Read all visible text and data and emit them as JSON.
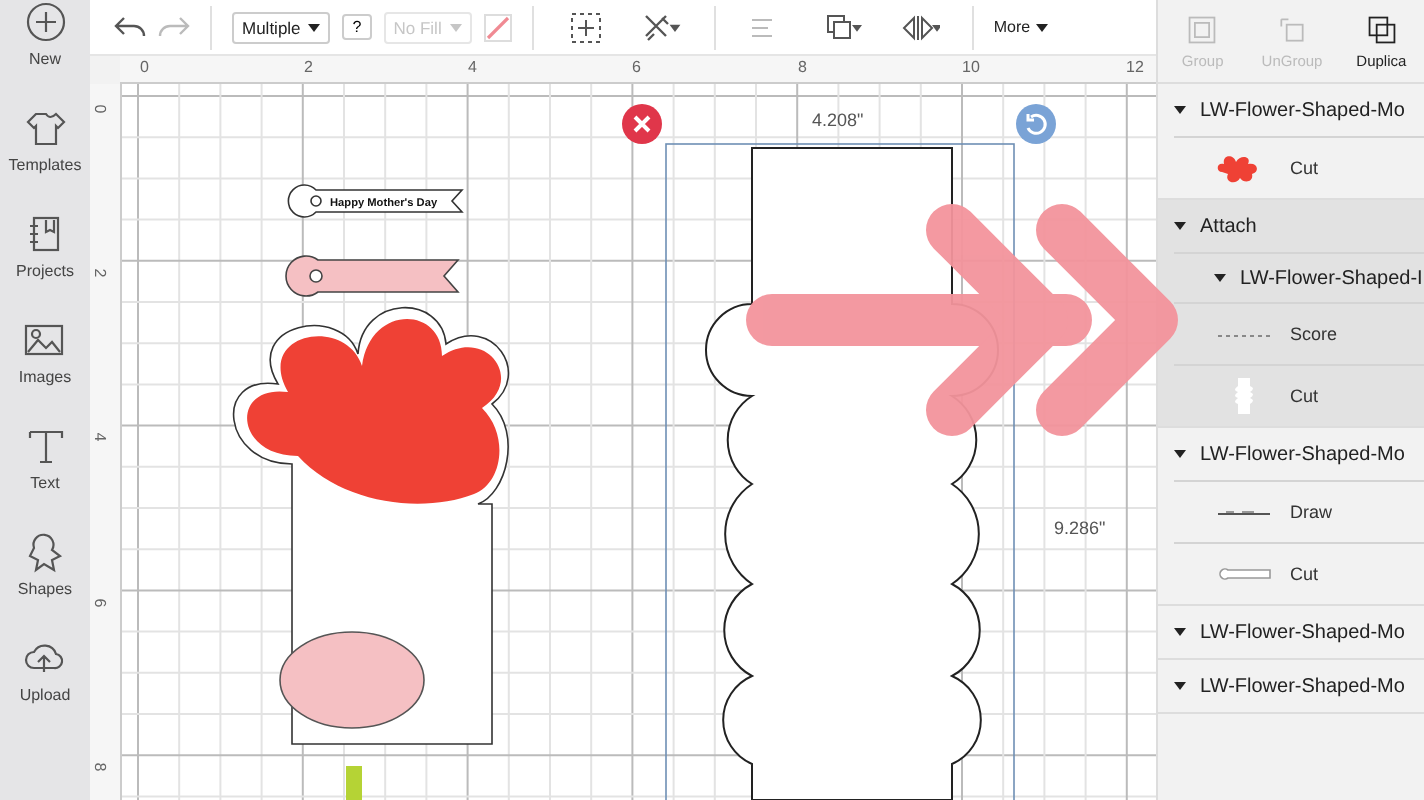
{
  "sidebar": [
    {
      "kind": "new",
      "label": "New"
    },
    {
      "kind": "templates",
      "label": "Templates"
    },
    {
      "kind": "projects",
      "label": "Projects"
    },
    {
      "kind": "images",
      "label": "Images"
    },
    {
      "kind": "text",
      "label": "Text"
    },
    {
      "kind": "shapes",
      "label": "Shapes"
    },
    {
      "kind": "upload",
      "label": "Upload"
    }
  ],
  "toolbar": {
    "linetype": {
      "value": "Multiple"
    },
    "help_button": "?",
    "fill": {
      "value": "No Fill",
      "disabled": true
    },
    "more_button": "More"
  },
  "rulers": {
    "horizontal": [
      "0",
      "2",
      "4",
      "6",
      "8",
      "10",
      "12"
    ],
    "vertical": [
      "0",
      "2",
      "4",
      "6",
      "8"
    ]
  },
  "canvas": {
    "tag_text": "Happy Mother's Day",
    "width_label": "4.208\"",
    "height_label": "9.286\""
  },
  "panel": {
    "actions": [
      {
        "kind": "group",
        "label": "Group",
        "disabled": true
      },
      {
        "kind": "ungroup",
        "label": "UnGroup",
        "disabled": true
      },
      {
        "kind": "duplicate",
        "label": "Duplica",
        "disabled": false
      }
    ],
    "layers": [
      {
        "name": "LW-Flower-Shaped-Mo",
        "expanded": true,
        "selected": false,
        "children": [
          {
            "kind": "flower",
            "label": "Cut"
          }
        ]
      },
      {
        "name": "Attach",
        "expanded": true,
        "selected": true,
        "children": [
          {
            "kind": "group",
            "name": "LW-Flower-Shaped-I",
            "expanded": true,
            "children": [
              {
                "kind": "dashed",
                "label": "Score"
              },
              {
                "kind": "card",
                "label": "Cut"
              }
            ]
          }
        ]
      },
      {
        "name": "LW-Flower-Shaped-Mo",
        "expanded": true,
        "selected": false,
        "children": [
          {
            "kind": "line",
            "label": "Draw"
          },
          {
            "kind": "tag",
            "label": "Cut"
          }
        ]
      },
      {
        "name": "LW-Flower-Shaped-Mo",
        "expanded": true,
        "selected": false
      },
      {
        "name": "LW-Flower-Shaped-Mo",
        "expanded": true,
        "selected": false
      }
    ]
  }
}
